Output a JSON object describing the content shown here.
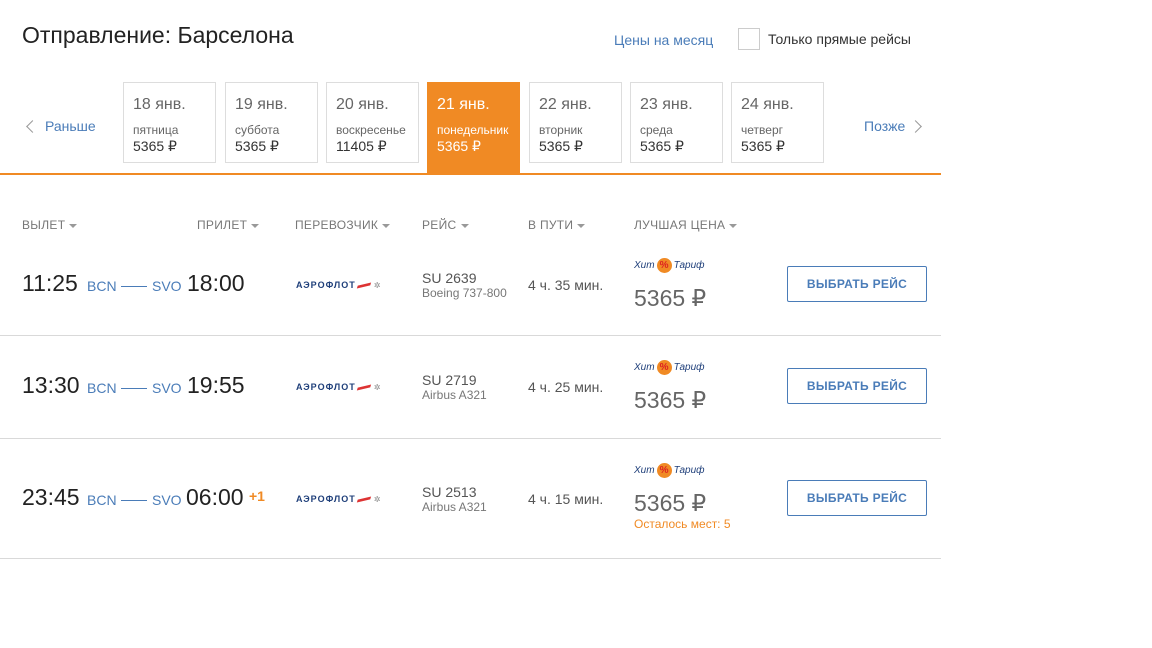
{
  "header": {
    "title": "Отправление: Барселона",
    "month_prices_link": "Цены на месяц",
    "direct_only_label": "Только прямые рейсы"
  },
  "nav": {
    "prev": "Раньше",
    "next": "Позже"
  },
  "dates": [
    {
      "date": "18 янв.",
      "day": "пятница",
      "price": "5365 ₽",
      "active": false
    },
    {
      "date": "19 янв.",
      "day": "суббота",
      "price": "5365 ₽",
      "active": false
    },
    {
      "date": "20 янв.",
      "day": "воскресенье",
      "price": "11405 ₽",
      "active": false
    },
    {
      "date": "21 янв.",
      "day": "понедельник",
      "price": "5365 ₽",
      "active": true
    },
    {
      "date": "22 янв.",
      "day": "вторник",
      "price": "5365 ₽",
      "active": false
    },
    {
      "date": "23 янв.",
      "day": "среда",
      "price": "5365 ₽",
      "active": false
    },
    {
      "date": "24 янв.",
      "day": "четверг",
      "price": "5365 ₽",
      "active": false
    }
  ],
  "columns": {
    "departure": "ВЫЛЕТ",
    "arrival": "ПРИЛЕТ",
    "carrier": "ПЕРЕВОЗЧИК",
    "flight": "РЕЙС",
    "duration": "В ПУТИ",
    "best_price": "ЛУЧШАЯ ЦЕНА"
  },
  "carrier_logo_text": "АЭРОФЛОТ",
  "tariff": {
    "left": "Хит",
    "badge": "%",
    "right": "Тариф"
  },
  "select_label": "ВЫБРАТЬ РЕЙС",
  "flights": [
    {
      "dep_time": "11:25",
      "dep_ap": "BCN",
      "arr_ap": "SVO",
      "arr_time": "18:00",
      "next_day": "",
      "number": "SU 2639",
      "aircraft": "Boeing 737-800",
      "duration": "4 ч. 35 мин.",
      "price": "5365 ₽",
      "seats": ""
    },
    {
      "dep_time": "13:30",
      "dep_ap": "BCN",
      "arr_ap": "SVO",
      "arr_time": "19:55",
      "next_day": "",
      "number": "SU 2719",
      "aircraft": "Airbus A321",
      "duration": "4 ч. 25 мин.",
      "price": "5365 ₽",
      "seats": ""
    },
    {
      "dep_time": "23:45",
      "dep_ap": "BCN",
      "arr_ap": "SVO",
      "arr_time": "06:00",
      "next_day": "+1",
      "number": "SU 2513",
      "aircraft": "Airbus A321",
      "duration": "4 ч. 15 мин.",
      "price": "5365 ₽",
      "seats": "Осталось мест: 5"
    }
  ],
  "colors": {
    "accent": "#f08a24",
    "link": "#4a7cb8"
  }
}
